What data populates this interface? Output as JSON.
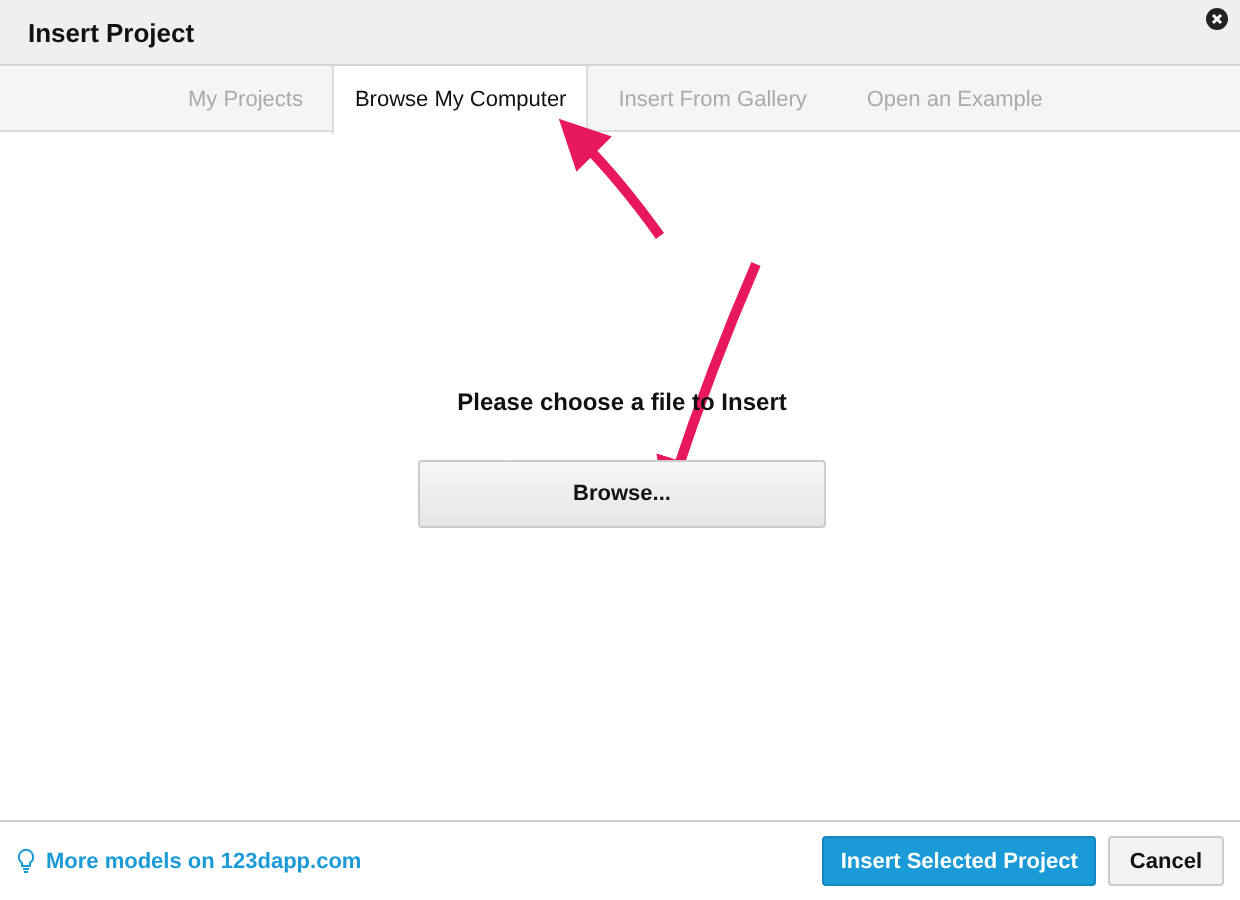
{
  "window": {
    "title": "Insert Project"
  },
  "tabs": [
    {
      "label": "My Projects",
      "selected": false
    },
    {
      "label": "Browse My Computer",
      "selected": true
    },
    {
      "label": "Insert From Gallery",
      "selected": false
    },
    {
      "label": "Open an Example",
      "selected": false
    }
  ],
  "body": {
    "prompt": "Please choose a file to Insert",
    "browse_button": "Browse..."
  },
  "footer": {
    "link": "More models on 123dapp.com",
    "buttons": [
      {
        "label": "Insert Selected Project",
        "kind": "primary"
      },
      {
        "label": "Cancel",
        "kind": "secondary"
      }
    ]
  }
}
